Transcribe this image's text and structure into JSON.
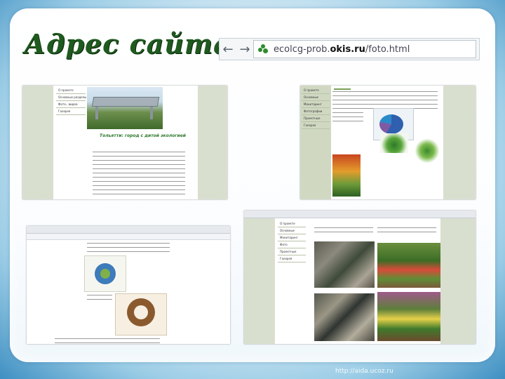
{
  "slide": {
    "title": "Адрес сайта:",
    "watermark": "http://aida.ucoz.ru"
  },
  "address_bar": {
    "back_icon": "arrow-left-icon",
    "forward_icon": "arrow-right-icon",
    "url_prefix": "ecolcg-prob.",
    "url_host": "okis.ru",
    "url_path": "/foto.html"
  },
  "screenshots": [
    {
      "menu": [
        "О проекте",
        "Основные разделы",
        "Фото-, видео-",
        "Галерея"
      ],
      "green_heading": "Тольятти: город с дитой экологией"
    },
    {
      "menu": [
        "О проекте",
        "Основные",
        "Мониторинг",
        "Фотографии",
        "Проектные",
        "Галерея"
      ]
    },
    {
      "menu": []
    },
    {
      "menu": [
        "О проекте",
        "Основные",
        "Мониторинг",
        "Фото",
        "Проектные",
        "Галерея"
      ]
    }
  ]
}
